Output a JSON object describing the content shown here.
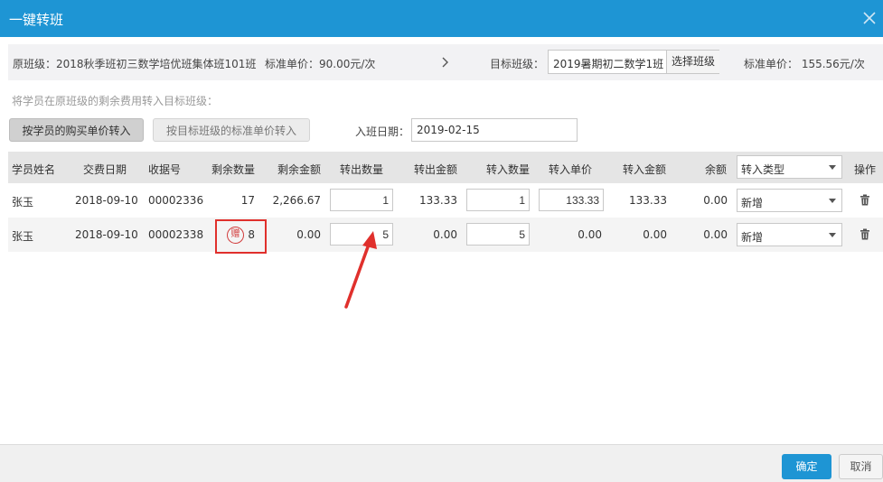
{
  "dialog": {
    "title": "一键转班"
  },
  "class_bar": {
    "original_class": "原班级：2018秋季班初三数学培优班集体班101班",
    "original_price": "标准单价：90.00元/次",
    "target_label": "目标班级：",
    "target_value": "2019暑期初二数学1班",
    "select_button": "选择班级",
    "target_price": "标准单价： 155.56元/次"
  },
  "hint": "将学员在原班级的剩余费用转入目标班级：",
  "modes": {
    "by_purchase": "按学员的购买单价转入",
    "by_standard": "按目标班级的标准单价转入"
  },
  "date": {
    "label": "入班日期：",
    "value": "2019-02-15"
  },
  "table": {
    "headers": {
      "name": "学员姓名",
      "pay_date": "交费日期",
      "receipt": "收据号",
      "remain_qty": "剩余数量",
      "remain_amt": "剩余金额",
      "out_qty": "转出数量",
      "out_amt": "转出金额",
      "in_qty": "转入数量",
      "in_price": "转入单价",
      "in_amt": "转入金额",
      "balance": "余额",
      "in_type": "转入类型",
      "action": "操作"
    },
    "rows": [
      {
        "name": "张玉",
        "pay_date": "2018-09-10",
        "receipt": "00002336",
        "remain_qty": "17",
        "remain_amt": "2,266.67",
        "out_qty": "1",
        "out_amt": "133.33",
        "in_qty": "1",
        "in_price": "133.33",
        "in_amt": "133.33",
        "balance": "0.00",
        "in_type": "新增"
      },
      {
        "name": "张玉",
        "pay_date": "2018-09-10",
        "receipt": "00002338",
        "gift_badge": "赠",
        "remain_qty": "8",
        "remain_amt": "0.00",
        "out_qty": "5",
        "out_amt": "0.00",
        "in_qty": "5",
        "in_price": "0.00",
        "in_amt": "0.00",
        "balance": "0.00",
        "in_type": "新增"
      }
    ]
  },
  "footer": {
    "ok": "确定",
    "cancel": "取消"
  },
  "colors": {
    "primary": "#1e95d4",
    "highlight": "#e0302c"
  },
  "icons": {
    "close": "close-icon",
    "arrow": "chevron-right-icon",
    "delete": "trash-icon"
  }
}
